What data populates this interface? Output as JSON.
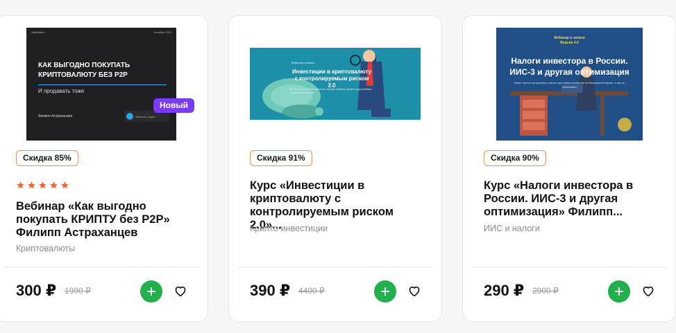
{
  "cards": [
    {
      "thumbnail": {
        "brand": "ЗайИнвест",
        "date": "Октябрь 2023",
        "heading": "КАК ВЫГОДНО ПОКУПАТЬ КРИПТОВАЛЮТУ БЕЗ P2P",
        "subheading": "И продавать тоже",
        "author": "Филипп Астраханцев",
        "telegram": "zaiinvest_crypto"
      },
      "badge": "Новый",
      "discount": "Скидка 85%",
      "rating": 5,
      "title": "Вебинар «Как выгодно покупать КРИПТУ без P2P» Филипп Астраханцев",
      "category": "Криптовалюты",
      "price": "300 ₽",
      "old_price": "1990 ₽"
    },
    {
      "thumbnail": {
        "caption": "Вебинар в записи",
        "heading": "Инвестиции в криптовалюту с контролируемым риском 2.0",
        "subheading": "Вы получите четкую стратегию, которая позволит решать ряд ключевых проблем криптовалют"
      },
      "discount": "Скидка 91%",
      "title": "Курс «Инвестиции в криптовалюту с контролируемым риском 2.0»...",
      "category": "Крипто-инвестиции",
      "price": "390 ₽",
      "old_price": "4400 ₽"
    },
    {
      "thumbnail": {
        "caption": "Вебинар в записи\nВерсия 4.0",
        "heading": "Налоги инвестора в России. ИИС-3 и другая оптимизация",
        "subheading": "Какие налоги вы должны платить при инвестировании на Московской бирже, и как их уменьшать"
      },
      "discount": "Скидка 90%",
      "title": "Курс «Налоги инвестора в России. ИИС-3 и другая оптимизация» Филипп...",
      "category": "ИИС и налоги",
      "price": "290 ₽",
      "old_price": "2900 ₽"
    }
  ],
  "colors": {
    "accent_green": "#21b04b",
    "discount_border": "#ff8a3d",
    "star": "#ff6a2a",
    "badge_new": "#7b3cf0"
  },
  "icons": {
    "add": "plus-icon",
    "favorite": "heart-icon",
    "rating": "star-icon",
    "telegram": "telegram-icon"
  }
}
